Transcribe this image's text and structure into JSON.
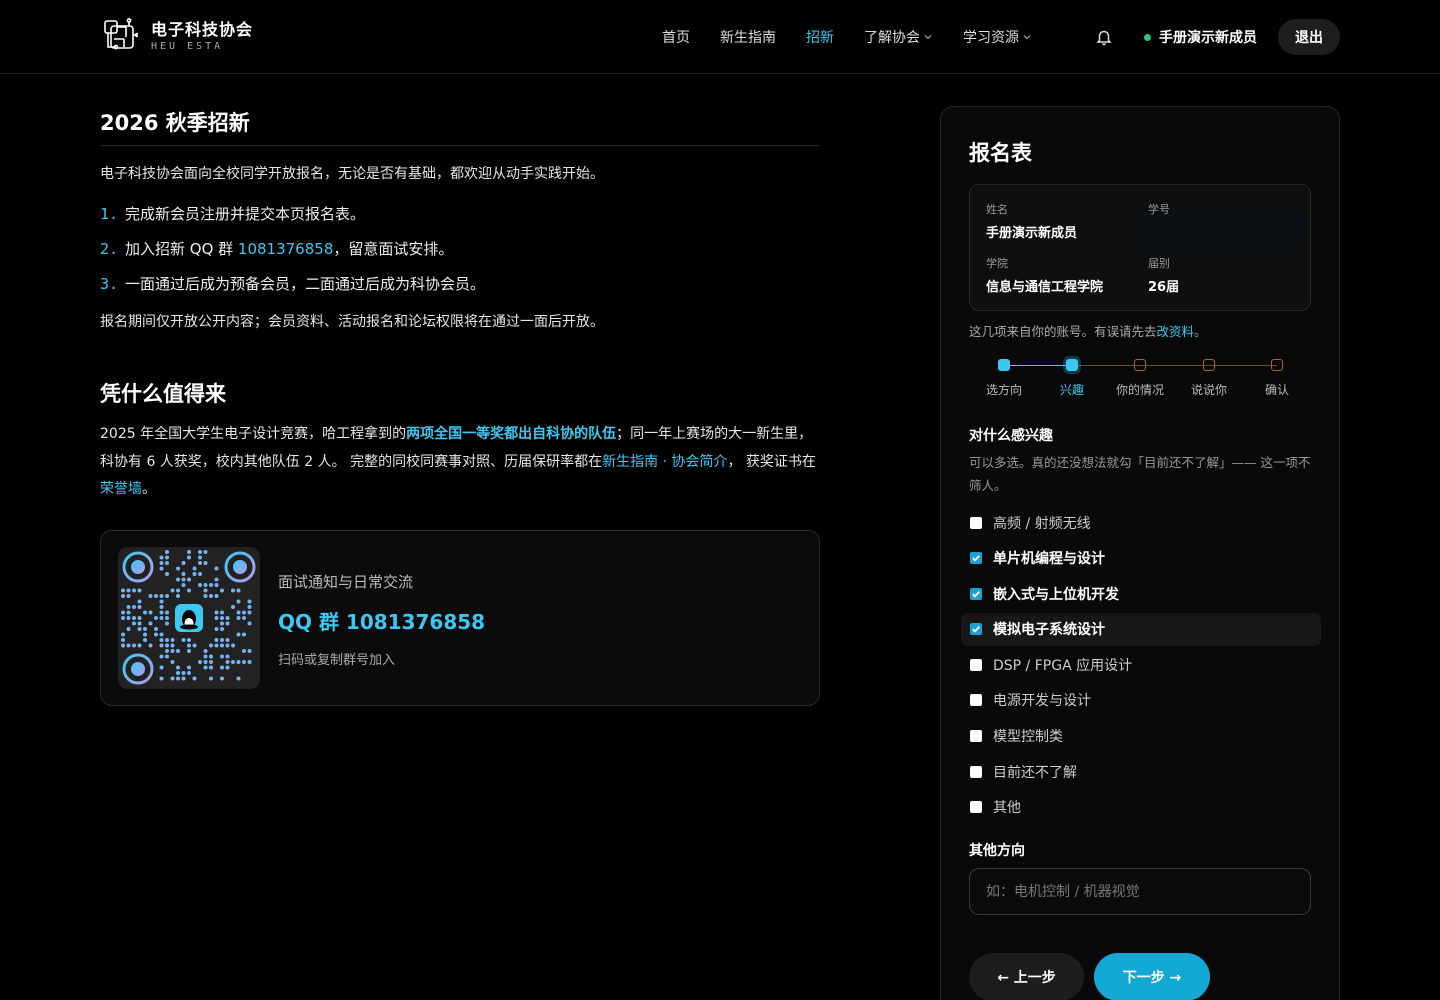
{
  "brand": {
    "name": "电子科技协会",
    "sub": "HEU ESTA",
    "logo_icon": "circuit-logo-icon"
  },
  "nav": [
    {
      "label": "首页",
      "active": false,
      "dropdown": false
    },
    {
      "label": "新生指南",
      "active": false,
      "dropdown": false
    },
    {
      "label": "招新",
      "active": true,
      "dropdown": false
    },
    {
      "label": "了解协会",
      "active": false,
      "dropdown": true
    },
    {
      "label": "学习资源",
      "active": false,
      "dropdown": true
    }
  ],
  "header": {
    "notification_icon": "bell-icon",
    "user_name": "手册演示新成员",
    "status": "online",
    "logout_label": "退出"
  },
  "colors": {
    "accent": "#3cc8f0",
    "primary_button": "#14a8d4",
    "online": "#2ec27e",
    "background": "#000000"
  },
  "main": {
    "title": "2026 秋季招新",
    "intro": "电子科技协会面向全校同学开放报名，无论是否有基础，都欢迎从动手实践开始。",
    "steps": [
      {
        "num": "1.",
        "text": "完成新会员注册并提交本页报名表。"
      },
      {
        "num": "2.",
        "pre": "加入招新 QQ 群 ",
        "highlight": "1081376858",
        "post": "，留意面试安排。"
      },
      {
        "num": "3.",
        "text": "一面通过后成为预备会员，二面通过后成为科协会员。"
      }
    ],
    "note": "报名期间仅开放公开内容；会员资料、活动报名和论坛权限将在通过一面后开放。",
    "why_title": "凭什么值得来",
    "why": {
      "part1": "2025 年全国大学生电子设计竞赛，哈工程拿到的",
      "bold_link": "两项全国一等奖都出自科协的队伍",
      "part2": "；同一年上赛场的大一新生里，科协有 6 人获奖，校内其他队伍 2 人。 完整的同校同赛事对照、历届保研率都在",
      "link1": "新生指南 · 协会简介",
      "part3": "， 获奖证书在",
      "link2": "荣誉墙",
      "part4": "。"
    },
    "qq_card": {
      "caption": "面试通知与日常交流",
      "title": "QQ 群 1081376858",
      "hint": "扫码或复制群号加入",
      "qr_icon": "qq-penguin-icon"
    }
  },
  "form": {
    "title": "报名表",
    "info": {
      "name_label": "姓名",
      "name_value": "手册演示新成员",
      "id_label": "学号",
      "id_value": "",
      "college_label": "学院",
      "college_value": "信息与通信工程学院",
      "grade_label": "届别",
      "grade_value": "26届"
    },
    "from_note_pre": "这几项来自你的账号。有误请先去",
    "from_note_link": "改资料",
    "from_note_post": "。",
    "steps": [
      {
        "label": "选方向",
        "state": "done"
      },
      {
        "label": "兴趣",
        "state": "current"
      },
      {
        "label": "你的情况",
        "state": "todo"
      },
      {
        "label": "说说你",
        "state": "todo"
      },
      {
        "label": "确认",
        "state": "todo"
      }
    ],
    "question_title": "对什么感兴趣",
    "question_hint": "可以多选。真的还没想法就勾「目前还不了解」—— 这一项不筛人。",
    "options": [
      {
        "label": "高频 / 射频无线",
        "checked": false
      },
      {
        "label": "单片机编程与设计",
        "checked": true
      },
      {
        "label": "嵌入式与上位机开发",
        "checked": true
      },
      {
        "label": "模拟电子系统设计",
        "checked": true
      },
      {
        "label": "DSP / FPGA 应用设计",
        "checked": false
      },
      {
        "label": "电源开发与设计",
        "checked": false
      },
      {
        "label": "模型控制类",
        "checked": false
      },
      {
        "label": "目前还不了解",
        "checked": false
      },
      {
        "label": "其他",
        "checked": false
      }
    ],
    "other_title": "其他方向",
    "other_placeholder": "如：电机控制 / 机器视觉",
    "other_value": "",
    "prev_label": "← 上一步",
    "next_label": "下一步 →"
  }
}
